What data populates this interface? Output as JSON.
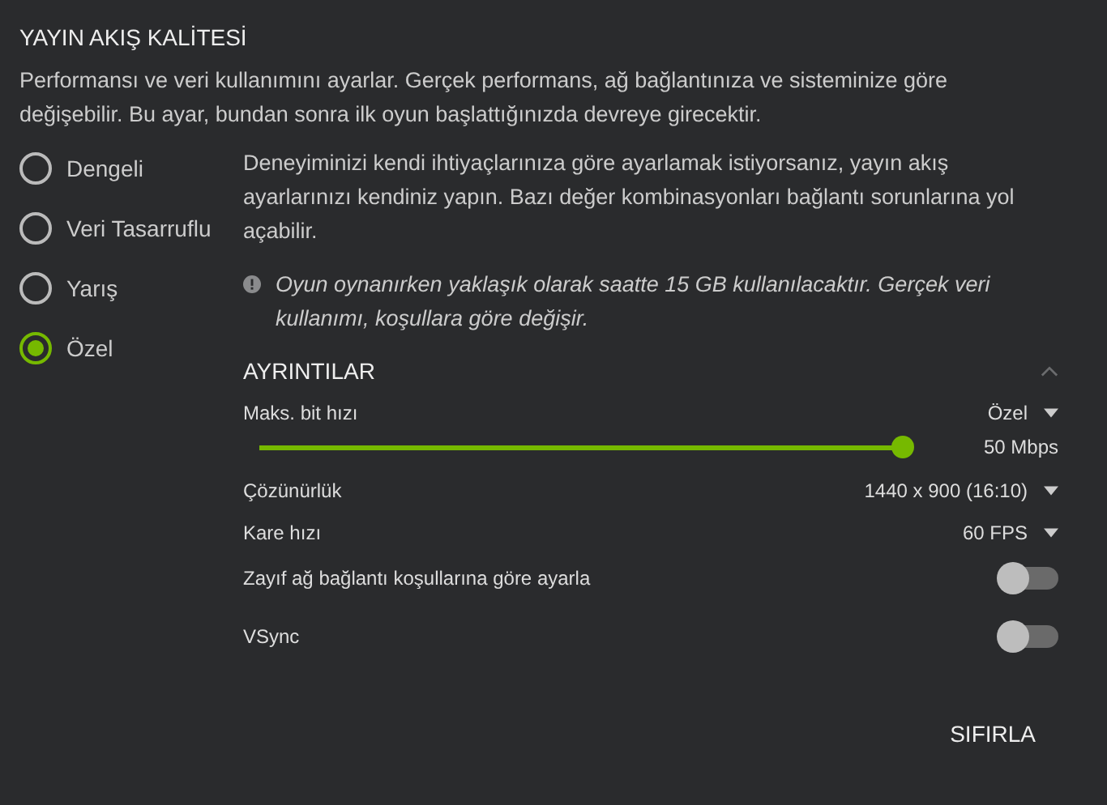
{
  "title": "YAYIN AKIŞ KALİTESİ",
  "description": "Performansı ve veri kullanımını ayarlar. Gerçek performans, ağ bağlantınıza ve sisteminize göre değişebilir. Bu ayar, bundan sonra ilk oyun başlattığınızda devreye girecektir.",
  "presets": [
    {
      "label": "Dengeli",
      "selected": false
    },
    {
      "label": "Veri Tasarruflu",
      "selected": false
    },
    {
      "label": "Yarış",
      "selected": false
    },
    {
      "label": "Özel",
      "selected": true
    }
  ],
  "custom_text": "Deneyiminizi kendi ihtiyaçlarınıza göre ayarlamak istiyorsanız, yayın akış ayarlarınızı kendiniz yapın. Bazı değer kombinasyonları bağlantı sorunlarına yol açabilir.",
  "notice": "Oyun oynanırken yaklaşık olarak saatte 15 GB kullanılacaktır. Gerçek veri kullanımı, koşullara göre değişir.",
  "details": {
    "title": "AYRINTILAR",
    "expanded": true,
    "settings": [
      {
        "kind": "slider",
        "label": "Maks. bit hızı",
        "value": "Özel",
        "level": 1,
        "reading": "50 Mbps"
      },
      {
        "kind": "dropdown",
        "label": "Çözünürlük",
        "value": "1440 x 900 (16:10)"
      },
      {
        "kind": "dropdown",
        "label": "Kare hızı",
        "value": "60 FPS"
      },
      {
        "kind": "toggle",
        "label": "Zayıf ağ bağlantı koşullarına göre ayarla",
        "on": false
      },
      {
        "kind": "toggle",
        "label": "VSync",
        "on": false
      }
    ]
  },
  "reset_button": "SIFIRLA"
}
